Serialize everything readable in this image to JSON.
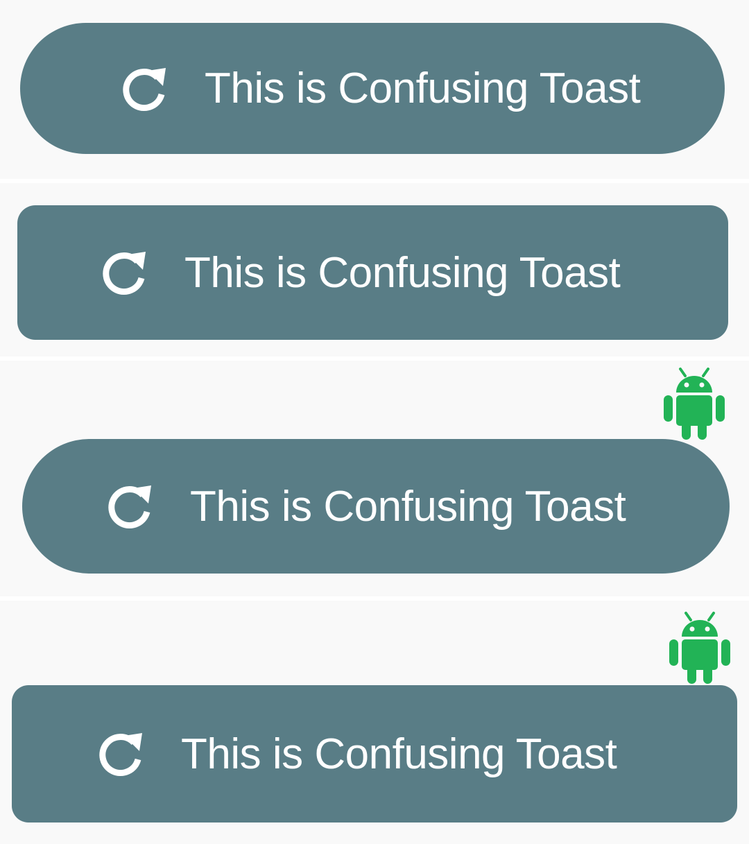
{
  "toasts": [
    {
      "variant": "pill",
      "icon": "refresh-icon",
      "message": "This is Confusing Toast",
      "badge_icon": null
    },
    {
      "variant": "rounded-rect",
      "icon": "refresh-icon",
      "message": "This is Confusing Toast",
      "badge_icon": null
    },
    {
      "variant": "pill",
      "icon": "refresh-icon",
      "message": "This is Confusing Toast",
      "badge_icon": "android-icon"
    },
    {
      "variant": "rounded-rect",
      "icon": "refresh-icon",
      "message": "This is Confusing Toast",
      "badge_icon": "android-icon"
    }
  ],
  "colors": {
    "toast_background": "#597d86",
    "toast_text": "#ffffff",
    "panel_background": "#f9f9f9",
    "separator": "#ffffff",
    "android_green": "#22b356"
  }
}
